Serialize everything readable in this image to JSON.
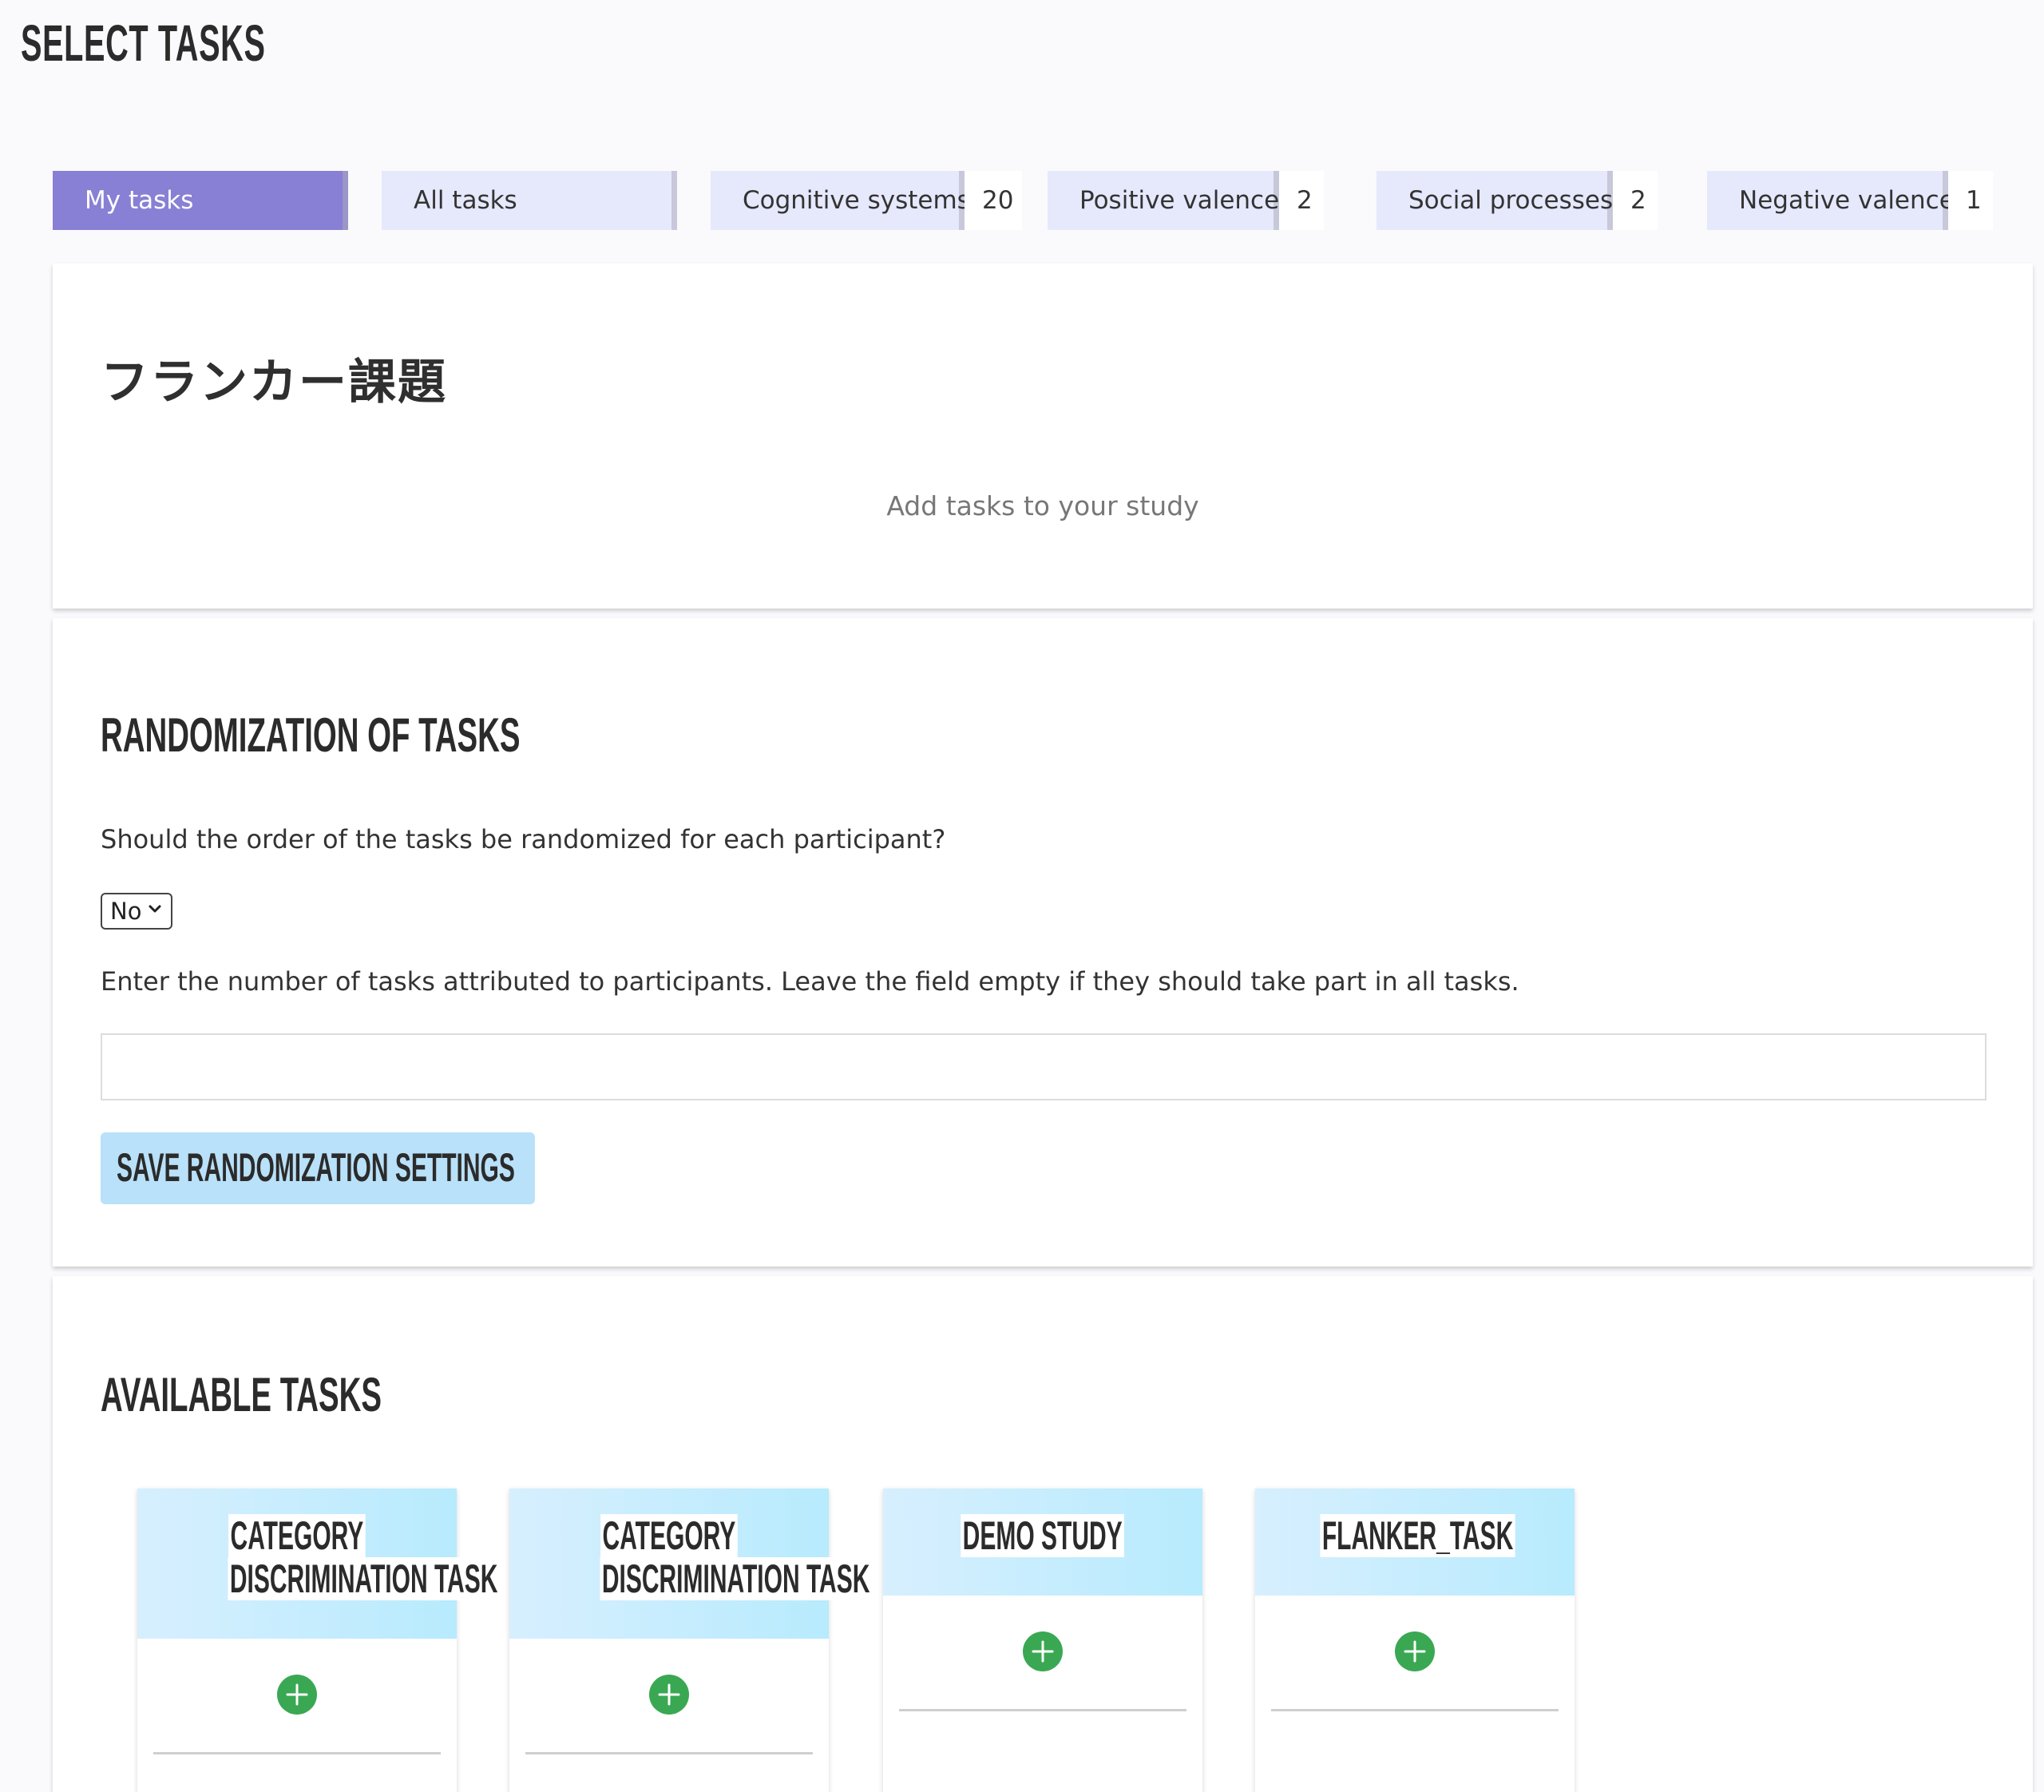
{
  "page_title": "SELECT TASKS",
  "tabs": {
    "my_tasks": "My tasks",
    "all_tasks": "All tasks",
    "categories": [
      {
        "label": "Cognitive systems",
        "count": "20"
      },
      {
        "label": "Positive valence",
        "count": "2"
      },
      {
        "label": "Social processes",
        "count": "2"
      },
      {
        "label": "Negative valence",
        "count": "1"
      }
    ]
  },
  "study": {
    "title": "フランカー課題",
    "empty_note": "Add tasks to your study"
  },
  "randomization": {
    "heading": "RANDOMIZATION OF TASKS",
    "question": "Should the order of the tasks be randomized for each participant?",
    "selected": "No",
    "instructions": "Enter the number of tasks attributed to participants. Leave the field empty if they should take part in all tasks.",
    "number_value": "",
    "save_label": "SAVE RANDOMIZATION SETTINGS"
  },
  "available": {
    "heading": "AVAILABLE TASKS",
    "tasks": [
      {
        "line1": "CATEGORY",
        "line2": "DISCRIMINATION TASK"
      },
      {
        "line1": "CATEGORY",
        "line2": "DISCRIMINATION TASK"
      },
      {
        "line1": "DEMO STUDY",
        "line2": ""
      },
      {
        "line1": "FLANKER_TASK",
        "line2": ""
      }
    ]
  },
  "colors": {
    "active_tab": "#8880d4",
    "tab": "#e6e8fc",
    "save_button": "#b9e1f9",
    "add_icon": "#3aa853"
  },
  "icons": {
    "select_arrow": "chevron-down-icon",
    "add": "plus-circle-icon"
  }
}
